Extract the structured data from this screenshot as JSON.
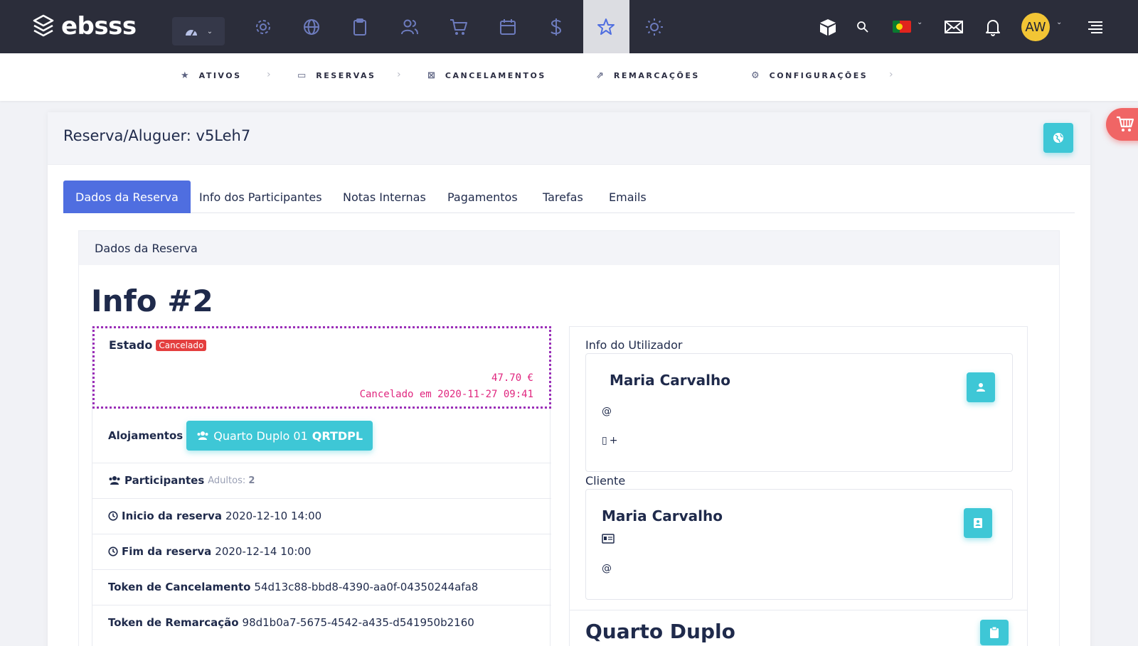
{
  "app": {
    "brand": "ebsss",
    "user_initials": "AW",
    "language_flag": "pt"
  },
  "topnav": {
    "icons": [
      "dashboard-icon",
      "gear-icon",
      "globe-icon",
      "clipboard-icon",
      "users-icon",
      "cart-icon",
      "calendar-icon",
      "dollar-icon",
      "star-icon",
      "sun-icon"
    ],
    "active": "star-icon",
    "right_icons": [
      "cube-icon",
      "search-icon",
      "flag-icon",
      "mail-icon",
      "bell-icon",
      "avatar",
      "menu-icon"
    ]
  },
  "breadcrumb": {
    "items": [
      {
        "label": "ATIVOS",
        "icon": "star-icon"
      },
      {
        "label": "RESERVAS",
        "icon": "calendar-icon"
      },
      {
        "label": "CANCELAMENTOS",
        "icon": "x-square-icon"
      },
      {
        "label": "REMARCAÇÕES",
        "icon": "share-icon"
      },
      {
        "label": "CONFIGURAÇÕES",
        "icon": "cogs-icon"
      }
    ]
  },
  "card": {
    "title": "Reserva/Aluguer: v5Leh7",
    "tabs": [
      "Dados da Reserva",
      "Info dos Participantes",
      "Notas Internas",
      "Pagamentos",
      "Tarefas",
      "Emails"
    ],
    "active_tab": "Dados da Reserva"
  },
  "panel": {
    "header": "Dados da Reserva",
    "info_title": "Info #2",
    "estado": {
      "label": "Estado",
      "badge": "Cancelado",
      "amount": "47.70 €",
      "cancelled_at": "Cancelado em 2020-11-27 09:41"
    },
    "alojamentos": {
      "label": "Alojamentos",
      "button_text": "Quarto Duplo 01",
      "button_code": "QRTDPL"
    },
    "participantes": {
      "label": "Participantes",
      "adults_label": "Adultos:",
      "adults_value": "2"
    },
    "inicio": {
      "label": "Inicio da reserva",
      "value": "2020-12-10 14:00"
    },
    "fim": {
      "label": "Fim da reserva",
      "value": "2020-12-14 10:00"
    },
    "token_cancel": {
      "label": "Token de Cancelamento",
      "value": "54d13c88-bbd8-4390-aa0f-04350244afa8"
    },
    "token_remarc": {
      "label": "Token de Remarcação",
      "value": "98d1b0a7-5675-4542-a435-d541950b2160"
    }
  },
  "right": {
    "user_section": "Info do Utilizador",
    "user_name": "Maria Carvalho",
    "user_email_prefix": "@",
    "user_phone_prefix": "+",
    "client_section": "Cliente",
    "client_name": "Maria Carvalho",
    "client_email_prefix": "@",
    "room_title": "Quarto Duplo"
  },
  "colors": {
    "accent": "#4f6ee0",
    "teal": "#3ec7d6",
    "danger": "#e43e3e",
    "pink": "#e0267f",
    "topbar": "#2b2d3a"
  }
}
